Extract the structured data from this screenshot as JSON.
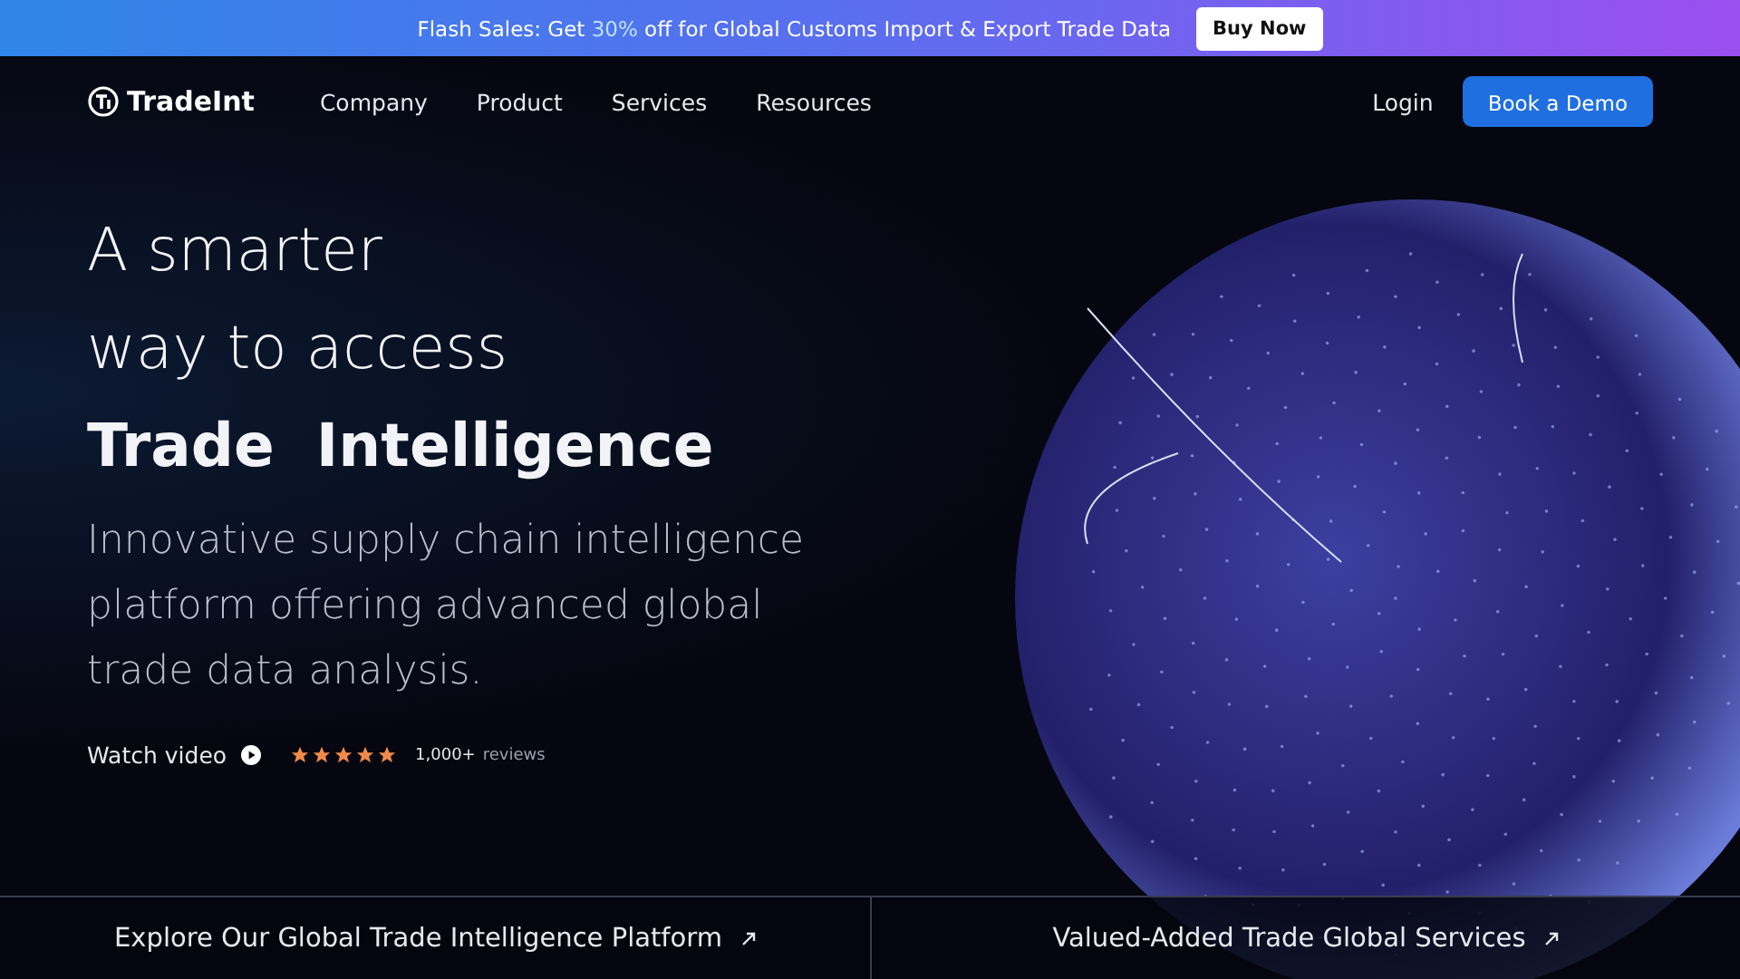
{
  "banner": {
    "text_before": "Flash Sales: Get ",
    "highlight": "30%",
    "text_after": " off for Global Customs Import & Export Trade Data",
    "button": "Buy Now"
  },
  "nav": {
    "logo": "TradeInt",
    "links": [
      "Company",
      "Product",
      "Services",
      "Resources"
    ],
    "login": "Login",
    "cta": "Book a Demo"
  },
  "hero": {
    "title_lines": [
      "A smarter",
      "way to access"
    ],
    "title_bold": "Trade  Intelligence",
    "subtitle": "Innovative supply chain intelligence platform offering advanced global trade data analysis.",
    "watch_video": "Watch video",
    "stars": 5,
    "reviews_count": "1,000+",
    "reviews_label": "reviews"
  },
  "bottom_links": [
    "Explore Our Global Trade Intelligence Platform",
    "Valued-Added Trade Global Services"
  ]
}
